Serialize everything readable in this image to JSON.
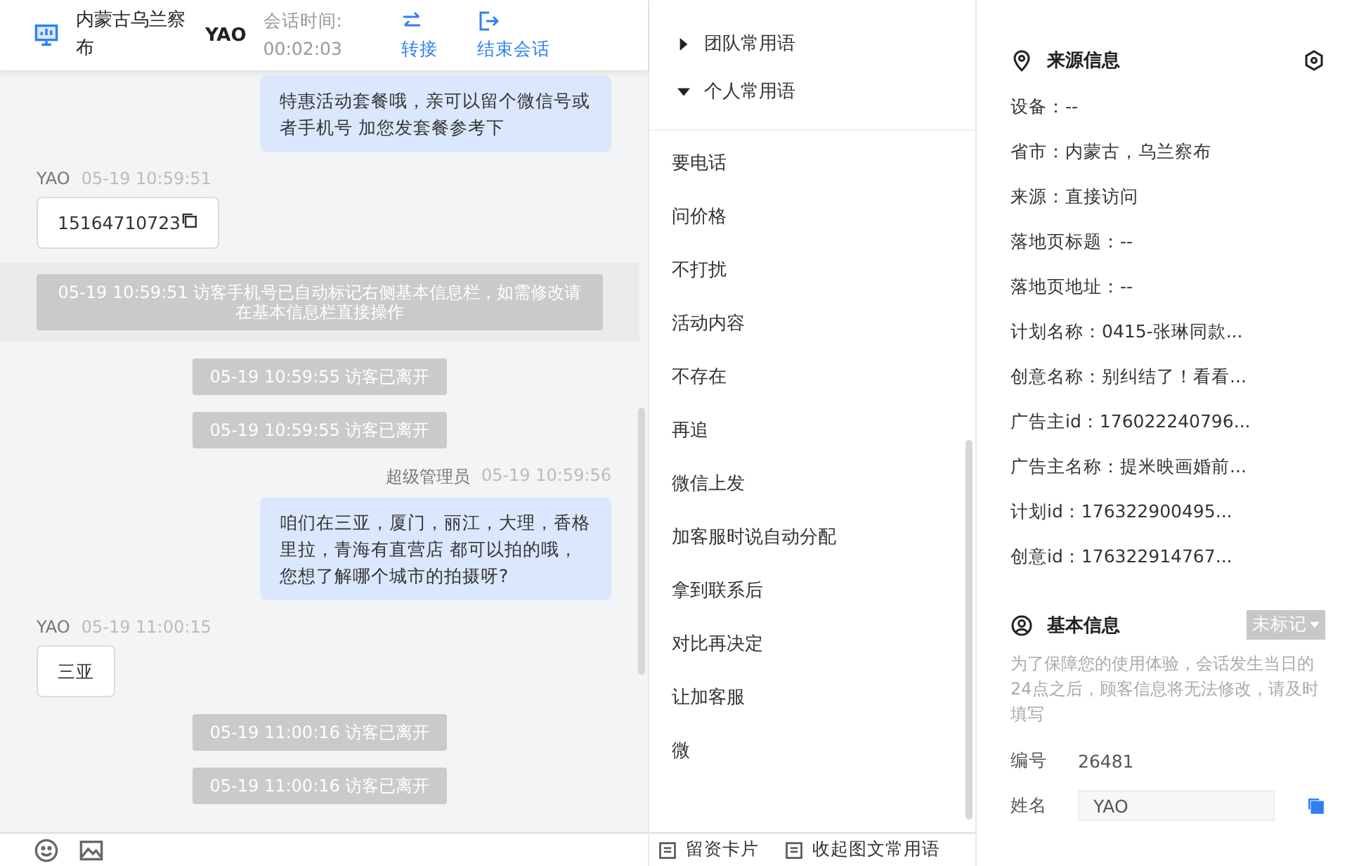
{
  "header": {
    "location": "内蒙古乌兰察布",
    "visitor": "YAO",
    "session_label": "会话时间:",
    "session_time": "00:02:03",
    "actions": [
      {
        "kind": "transfer",
        "label": "转接"
      },
      {
        "kind": "end",
        "label": "结束会话"
      }
    ]
  },
  "messages": [
    {
      "kind": "agent",
      "text": "特惠活动套餐哦，亲可以留个微信号或者手机号 加您发套餐参考下"
    },
    {
      "kind": "customer",
      "sender": "YAO",
      "time": "05-19 10:59:51",
      "text": "15164710723",
      "copyable": true
    },
    {
      "kind": "notice",
      "text": "05-19 10:59:51 访客手机号已自动标记右侧基本信息栏，如需修改请在基本信息栏直接操作",
      "highlighted": true
    },
    {
      "kind": "notice",
      "text": "05-19 10:59:55 访客已离开",
      "highlighted": false
    },
    {
      "kind": "notice",
      "text": "05-19 10:59:55 访客已离开",
      "highlighted": false
    },
    {
      "kind": "agent",
      "sender": "超级管理员",
      "time": "05-19 10:59:56",
      "text": "咱们在三亚，厦门，丽江，大理，香格里拉，青海有直营店 都可以拍的哦，您想了解哪个城市的拍摄呀?"
    },
    {
      "kind": "customer",
      "sender": "YAO",
      "time": "05-19 11:00:15",
      "text": "三亚",
      "copyable": false
    },
    {
      "kind": "notice",
      "text": "05-19 11:00:16 访客已离开",
      "highlighted": false
    },
    {
      "kind": "notice",
      "text": "05-19 11:00:16 访客已离开",
      "highlighted": false
    }
  ],
  "tools": [
    {
      "label": "留资卡片"
    },
    {
      "label": "收起图文常用语"
    }
  ],
  "phrase_groups": [
    {
      "title": "团队常用语",
      "expanded": false
    },
    {
      "title": "个人常用语",
      "expanded": true,
      "items": [
        "要电话",
        "问价格",
        "不打扰",
        "活动内容",
        "不存在",
        "再追",
        "微信上发",
        "加客服时说自动分配",
        "拿到联系后",
        "对比再决定",
        "让加客服",
        "微"
      ]
    }
  ],
  "source_info": {
    "title": "来源信息",
    "fields": [
      "设备：--",
      "省市：内蒙古，乌兰察布",
      "来源：直接访问",
      "落地页标题：--",
      "落地页地址：--",
      "计划名称：0415-张琳同款...",
      "创意名称：别纠结了！看看...",
      "广告主id：176022240796...",
      "广告主名称：提米映画婚前...",
      "计划id：176322900495...",
      "创意id：176322914767..."
    ]
  },
  "basic_info": {
    "title": "基本信息",
    "tag": "未标记",
    "notice": "为了保障您的使用体验，会话发生当日的24点之后，顾客信息将无法修改，请及时填写",
    "number_label": "编号",
    "number": "26481",
    "name_label": "姓名",
    "name_value": "YAO"
  }
}
